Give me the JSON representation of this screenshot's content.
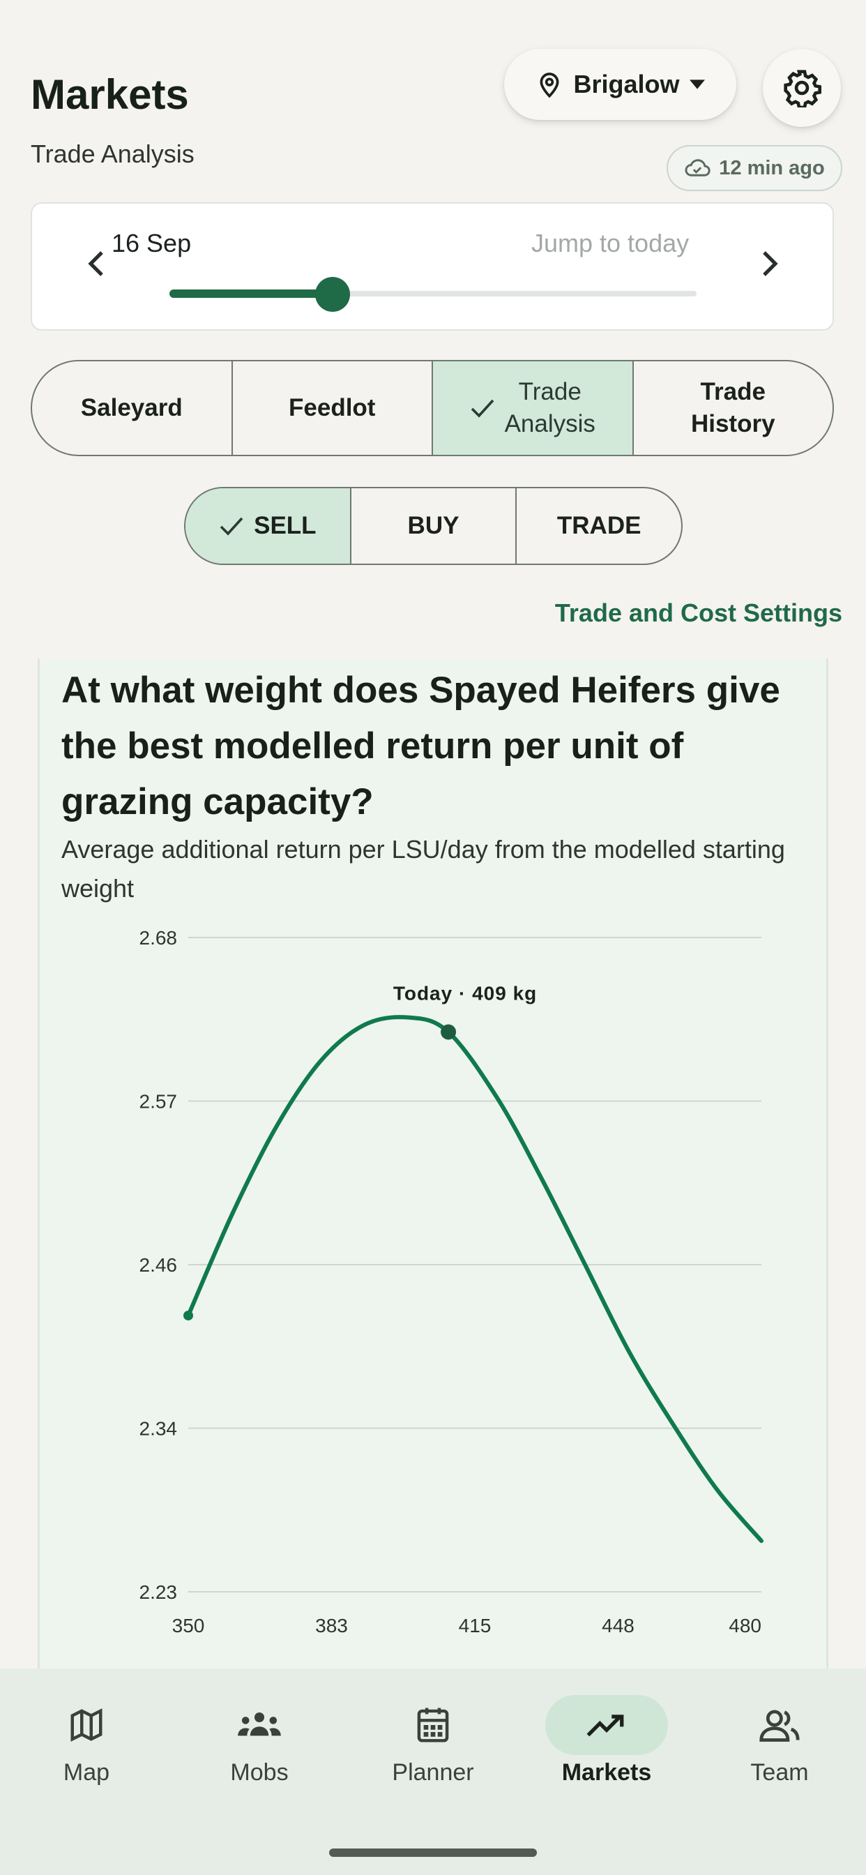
{
  "header": {
    "title": "Markets",
    "subtitle": "Trade Analysis",
    "location": "Brigalow",
    "sync_status": "12 min ago"
  },
  "date_picker": {
    "date": "16 Sep",
    "jump_label": "Jump to today",
    "slider_value": 0.31
  },
  "view_tabs": [
    {
      "label": "Saleyard",
      "selected": false
    },
    {
      "label": "Feedlot",
      "selected": false
    },
    {
      "label": "Trade\nAnalysis",
      "selected": true
    },
    {
      "label": "Trade\nHistory",
      "selected": false
    }
  ],
  "mode_tabs": [
    {
      "label": "SELL",
      "selected": true
    },
    {
      "label": "BUY",
      "selected": false
    },
    {
      "label": "TRADE",
      "selected": false
    }
  ],
  "settings_link": "Trade and Cost Settings",
  "card": {
    "question": "At what weight does Spayed Heifers give the best modelled return per unit of grazing capacity?",
    "description": "Average additional return per LSU/day from the modelled starting weight"
  },
  "chart_data": {
    "type": "line",
    "title": "",
    "xlabel": "",
    "ylabel": "",
    "xlim": [
      350,
      480
    ],
    "ylim": [
      2.23,
      2.68
    ],
    "x_ticks": [
      "350",
      "383",
      "415",
      "448",
      "480"
    ],
    "y_ticks": [
      "2.68",
      "2.57",
      "2.46",
      "2.34",
      "2.23"
    ],
    "grid": true,
    "color": "#0f7a4c",
    "series": [
      {
        "x": [
          350,
          360,
          370,
          380,
          390,
          400,
          409,
          420,
          430,
          440,
          450,
          460,
          470,
          480
        ],
        "y": [
          2.42,
          2.49,
          2.55,
          2.595,
          2.62,
          2.625,
          2.615,
          2.57,
          2.515,
          2.455,
          2.395,
          2.345,
          2.3,
          2.265
        ]
      }
    ],
    "annotation": {
      "x": 409,
      "y": 2.615,
      "label": "Today · 409 kg"
    }
  },
  "bottom_nav": [
    {
      "label": "Map",
      "icon": "map-icon",
      "active": false
    },
    {
      "label": "Mobs",
      "icon": "mobs-icon",
      "active": false
    },
    {
      "label": "Planner",
      "icon": "calendar-icon",
      "active": false
    },
    {
      "label": "Markets",
      "icon": "trending-up-icon",
      "active": true
    },
    {
      "label": "Team",
      "icon": "team-icon",
      "active": false
    }
  ]
}
